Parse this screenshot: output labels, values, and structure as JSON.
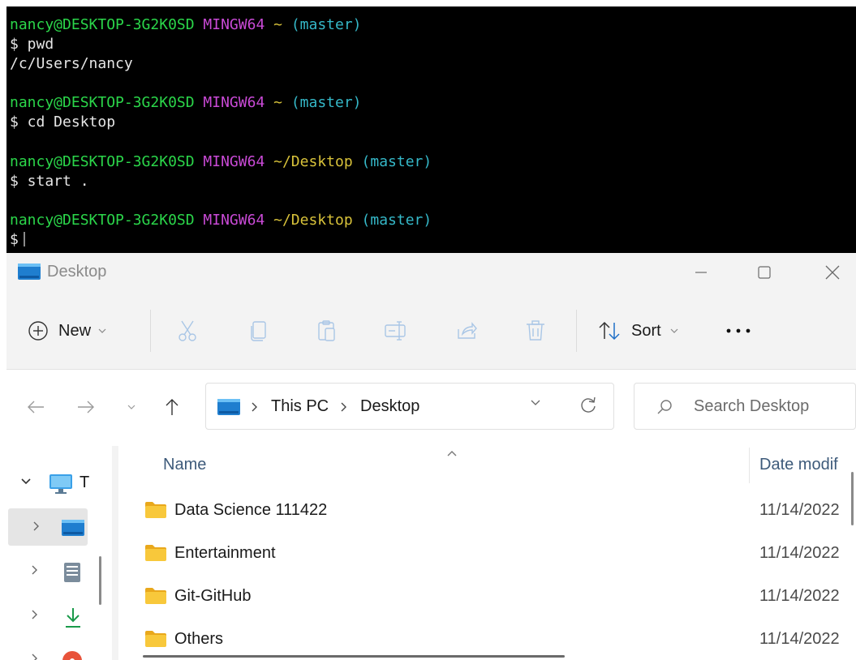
{
  "terminal": {
    "lines": [
      {
        "user": "nancy@DESKTOP-3G2K0SD",
        "shell": "MINGW64",
        "path": "~",
        "branch": "(master)"
      },
      {
        "cmd": "$ pwd"
      },
      {
        "out": "/c/Users/nancy"
      },
      {
        "user": "nancy@DESKTOP-3G2K0SD",
        "shell": "MINGW64",
        "path": "~",
        "branch": "(master)"
      },
      {
        "cmd": "$ cd Desktop"
      },
      {
        "user": "nancy@DESKTOP-3G2K0SD",
        "shell": "MINGW64",
        "path": "~/Desktop",
        "branch": "(master)"
      },
      {
        "cmd": "$ start ."
      },
      {
        "user": "nancy@DESKTOP-3G2K0SD",
        "shell": "MINGW64",
        "path": "~/Desktop",
        "branch": "(master)"
      },
      {
        "cmd": "$"
      }
    ],
    "colors": {
      "user": "#2bd64a",
      "shell": "#c94ad6",
      "path": "#d8c23a",
      "branch": "#35b8c8"
    }
  },
  "window": {
    "title": "Desktop",
    "controls": {
      "minimize": "minimize-icon",
      "maximize": "maximize-icon",
      "close": "close-icon"
    }
  },
  "toolbar": {
    "new_label": "New",
    "icons": [
      "cut-icon",
      "copy-icon",
      "paste-icon",
      "rename-icon",
      "share-icon",
      "delete-icon"
    ],
    "sort_label": "Sort",
    "more_icon": "more-icon"
  },
  "address": {
    "crumbs": [
      "This PC",
      "Desktop"
    ],
    "search_placeholder": "Search Desktop"
  },
  "navpane": {
    "this_pc_label": "T"
  },
  "filelist": {
    "columns": {
      "name": "Name",
      "date": "Date modif"
    },
    "rows": [
      {
        "name": "Data Science 111422",
        "date": "11/14/2022"
      },
      {
        "name": "Entertainment",
        "date": "11/14/2022"
      },
      {
        "name": "Git-GitHub",
        "date": "11/14/2022"
      },
      {
        "name": "Others",
        "date": "11/14/2022"
      }
    ]
  }
}
